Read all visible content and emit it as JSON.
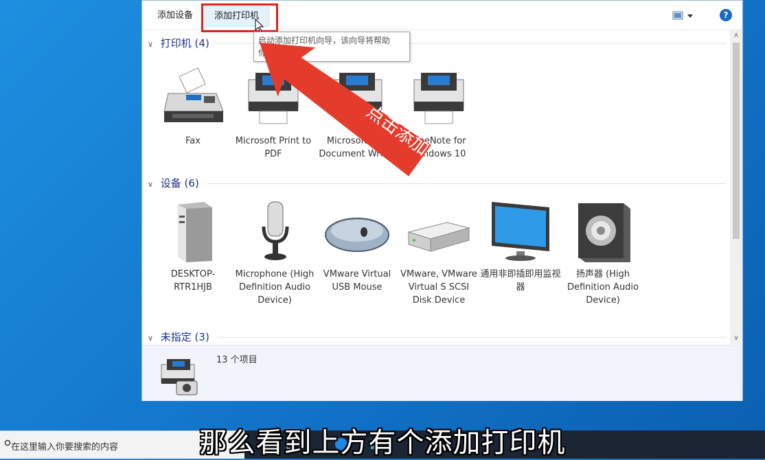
{
  "toolbar": {
    "add_device": "添加设备",
    "add_printer": "添加打印机",
    "help": "?"
  },
  "tooltip": {
    "line1": "启动添加打印机向导，该向导将帮助",
    "line2": "你"
  },
  "annotation": {
    "arrow_text": "点击添加",
    "color": "#e53b2c"
  },
  "sections": [
    {
      "title": "打印机 (4)",
      "items": [
        {
          "icon": "fax-icon",
          "label": "Fax"
        },
        {
          "icon": "printer-icon",
          "label": "Microsoft Print to PDF"
        },
        {
          "icon": "printer-icon",
          "label": "Microsoft XPS Document Writer"
        },
        {
          "icon": "printer-icon",
          "label": "OneNote for Windows 10"
        }
      ]
    },
    {
      "title": "设备 (6)",
      "items": [
        {
          "icon": "computer-tower-icon",
          "label": "DESKTOP-RTR1HJB"
        },
        {
          "icon": "microphone-icon",
          "label": "Microphone (High Definition Audio Device)"
        },
        {
          "icon": "mouse-icon",
          "label": "VMware Virtual USB Mouse"
        },
        {
          "icon": "disk-drive-icon",
          "label": "VMware, VMware Virtual S SCSI Disk Device"
        },
        {
          "icon": "monitor-icon",
          "label": "通用非即插即用监视器"
        },
        {
          "icon": "speaker-icon",
          "label": "扬声器 (High Definition Audio Device)"
        }
      ]
    },
    {
      "title": "未指定 (3)",
      "items": []
    }
  ],
  "details": {
    "count": "13 个项目"
  },
  "taskbar": {
    "search_placeholder": "在这里输入你要搜索的内容"
  },
  "subtitle": "那么看到上方有个添加打印机"
}
